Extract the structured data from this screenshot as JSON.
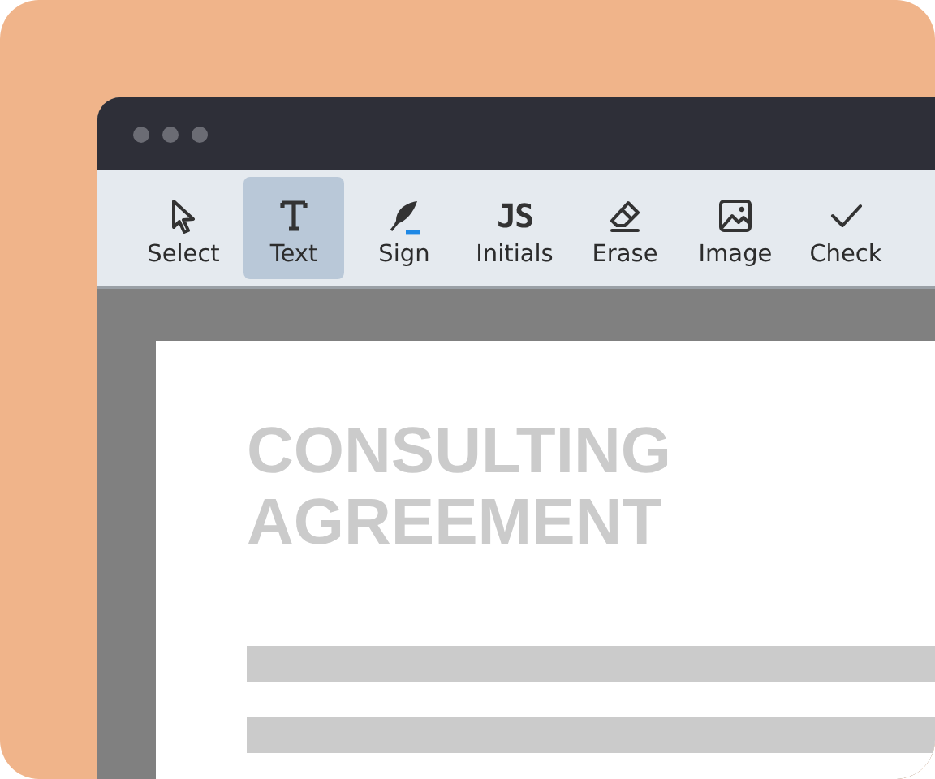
{
  "toolbar": {
    "tools": [
      {
        "label": "Select",
        "selected": false
      },
      {
        "label": "Text",
        "selected": true
      },
      {
        "label": "Sign",
        "selected": false
      },
      {
        "label": "Initials",
        "selected": false,
        "glyph": "JS"
      },
      {
        "label": "Erase",
        "selected": false
      },
      {
        "label": "Image",
        "selected": false
      },
      {
        "label": "Check",
        "selected": false
      }
    ]
  },
  "document": {
    "title_lines": [
      "CONSULTING",
      "AGREEMENT"
    ]
  }
}
